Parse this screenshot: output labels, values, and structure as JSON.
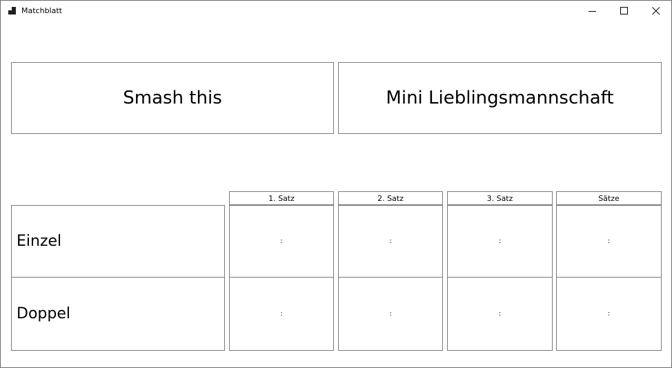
{
  "window": {
    "title": "Matchblatt",
    "controls": {
      "minimize_icon": "minimize-icon",
      "maximize_icon": "maximize-icon",
      "close_icon": "close-icon"
    }
  },
  "teams": {
    "home": "Smash this",
    "away": "Mini Lieblingsmannschaft"
  },
  "table": {
    "headers": [
      "1. Satz",
      "2. Satz",
      "3. Satz",
      "Sätze"
    ],
    "rows": [
      {
        "label": "Einzel",
        "cells": [
          ":",
          ":",
          ":",
          ":"
        ]
      },
      {
        "label": "Doppel",
        "cells": [
          ":",
          ":",
          ":",
          ":"
        ]
      }
    ]
  }
}
